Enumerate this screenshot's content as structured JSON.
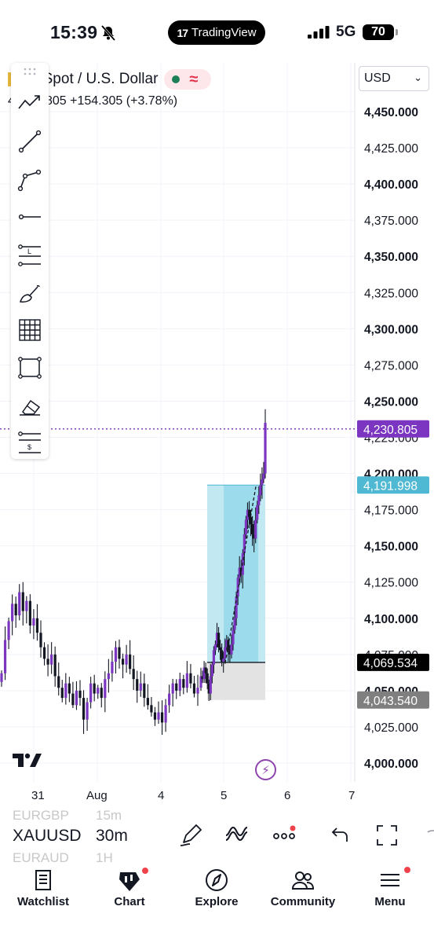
{
  "status_bar": {
    "time": "15:39",
    "app_pill": "TradingView",
    "app_pill_logo": "17",
    "network": "5G",
    "battery": "70"
  },
  "header": {
    "symbol_name": "old Spot / U.S. Dollar",
    "price_lead": "4",
    "price_change": "805  +154.305 (+3.78%)",
    "currency": "USD"
  },
  "tools": [
    {
      "name": "trend-line-tool-icon"
    },
    {
      "name": "line-tool-icon"
    },
    {
      "name": "path-tool-icon"
    },
    {
      "name": "horizontal-ray-icon"
    },
    {
      "name": "fib-retracement-icon"
    },
    {
      "name": "brush-icon"
    },
    {
      "name": "gann-grid-icon"
    },
    {
      "name": "rectangle-icon"
    },
    {
      "name": "eraser-icon"
    },
    {
      "name": "fixed-range-icon"
    }
  ],
  "chart_data": {
    "type": "candlestick",
    "symbol": "XAUUSD",
    "interval": "30m",
    "y_axis_labels": [
      "4,450.000",
      "4,425.000",
      "4,400.000",
      "4,375.000",
      "4,350.000",
      "4,325.000",
      "4,300.000",
      "4,275.000",
      "4,250.000",
      "4,225.000",
      "4,200.000",
      "4,175.000",
      "4,150.000",
      "4,125.000",
      "4,100.000",
      "4,075.000",
      "4,050.000",
      "4,025.000",
      "4,000.000"
    ],
    "y_axis_values": [
      4450,
      4425,
      4400,
      4375,
      4350,
      4325,
      4300,
      4275,
      4250,
      4225,
      4200,
      4175,
      4150,
      4125,
      4100,
      4075,
      4050,
      4025,
      4000
    ],
    "ylim": [
      3994,
      4470
    ],
    "x_axis_labels": [
      "31",
      "Aug",
      "4",
      "5",
      "6",
      "7"
    ],
    "price_tags": [
      {
        "label": "4,230.805",
        "value": 4230.805,
        "color": "#7b35c1"
      },
      {
        "label": "4,191.998",
        "value": 4191.998,
        "color": "#4fb8d2"
      },
      {
        "label": "4,069.534",
        "value": 4069.534,
        "color": "#000000"
      },
      {
        "label": "4,043.540",
        "value": 4043.54,
        "color": "#7f7f7f"
      }
    ],
    "long_position": {
      "entry": 4069.534,
      "target": 4191.998,
      "stop": 4043.54
    },
    "candle_color": "#7b35c1",
    "wick_color": "#131722",
    "series_close": [
      4062,
      4085,
      4098,
      4110,
      4102,
      4118,
      4105,
      4112,
      4095,
      4100,
      4090,
      4080,
      4072,
      4068,
      4075,
      4060,
      4052,
      4045,
      4055,
      4048,
      4040,
      4050,
      4045,
      4030,
      4042,
      4055,
      4048,
      4052,
      4045,
      4058,
      4062,
      4070,
      4080,
      4072,
      4068,
      4075,
      4065,
      4058,
      4050,
      4055,
      4045,
      4040,
      4035,
      4030,
      4035,
      4028,
      4040,
      4048,
      4055,
      4050,
      4058,
      4052,
      4062,
      4055,
      4048,
      4052,
      4060,
      4058,
      4066,
      4062,
      4055,
      4048,
      4060,
      4068,
      4078,
      4082,
      4090,
      4080,
      4078,
      4070,
      4072,
      4080,
      4085,
      4078,
      4075,
      4082,
      4092,
      4100,
      4115,
      4128,
      4135,
      4130,
      4145,
      4158,
      4168,
      4175,
      4170,
      4165,
      4158,
      4155,
      4168,
      4178,
      4185,
      4192,
      4196,
      4200,
      4235
    ]
  },
  "toolbar": {
    "symbol": "XAUUSD",
    "interval": "30m",
    "ghost_top_symbol": "EURGBP",
    "ghost_top_interval": "15m",
    "ghost_bottom_symbol": "EURAUD",
    "ghost_bottom_interval": "1H"
  },
  "bottom_nav": [
    {
      "label": "Watchlist",
      "icon": "watchlist-icon"
    },
    {
      "label": "Chart",
      "icon": "chart-icon"
    },
    {
      "label": "Explore",
      "icon": "compass-icon"
    },
    {
      "label": "Community",
      "icon": "community-icon"
    },
    {
      "label": "Menu",
      "icon": "menu-icon"
    }
  ]
}
